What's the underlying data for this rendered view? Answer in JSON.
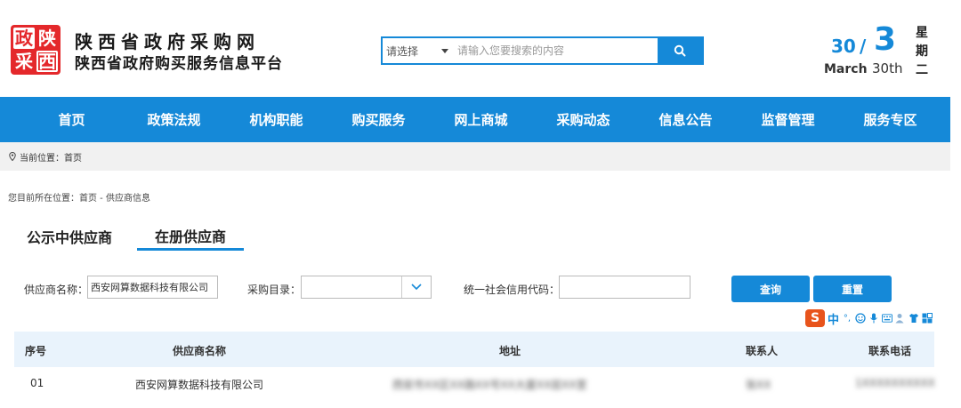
{
  "header": {
    "logo_chars": [
      "政",
      "陕",
      "采",
      "西"
    ],
    "title": "陕西省政府采购网",
    "subtitle": "陕西省政府购买服务信息平台"
  },
  "search": {
    "select_label": "请选择",
    "placeholder": "请输入您要搜索的内容",
    "icon": "search-icon"
  },
  "date": {
    "day": "30",
    "slash": "/",
    "month_num": "3",
    "month_name": "March",
    "ordinal": "30th",
    "weekday_chars": [
      "星",
      "期",
      "二"
    ]
  },
  "nav": {
    "items": [
      "首页",
      "政策法规",
      "机构职能",
      "购买服务",
      "网上商城",
      "采购动态",
      "信息公告",
      "监督管理",
      "服务专区"
    ]
  },
  "breadcrumb": {
    "text": "当前位置：首页",
    "icon": "location-pin-icon"
  },
  "location": {
    "text": "您目前所在位置：首页 - 供应商信息"
  },
  "tabs": [
    "公示中供应商",
    "在册供应商"
  ],
  "filters": {
    "supplier_name_label": "供应商名称：",
    "supplier_name_value": "西安网算数据科技有限公司",
    "catalog_label": "采购目录：",
    "catalog_value": "",
    "credit_code_label": "统一社会信用代码：",
    "credit_code_value": "",
    "query_button": "查询",
    "reset_button": "重置"
  },
  "ime": {
    "logo": "S",
    "mode": "中",
    "punct": "°,"
  },
  "table": {
    "headers": [
      "序号",
      "供应商名称",
      "地址",
      "联系人",
      "联系电话"
    ],
    "rows": [
      {
        "index": "01",
        "name": "西安网算数据科技有限公司",
        "address": "西安市XX区XX路XX号XX大厦XX层XX室",
        "contact": "张XX",
        "phone": "1XXXXXXXXXX"
      }
    ]
  },
  "colors": {
    "primary_blue": "#1589d8",
    "logo_red": "#e4282b"
  }
}
